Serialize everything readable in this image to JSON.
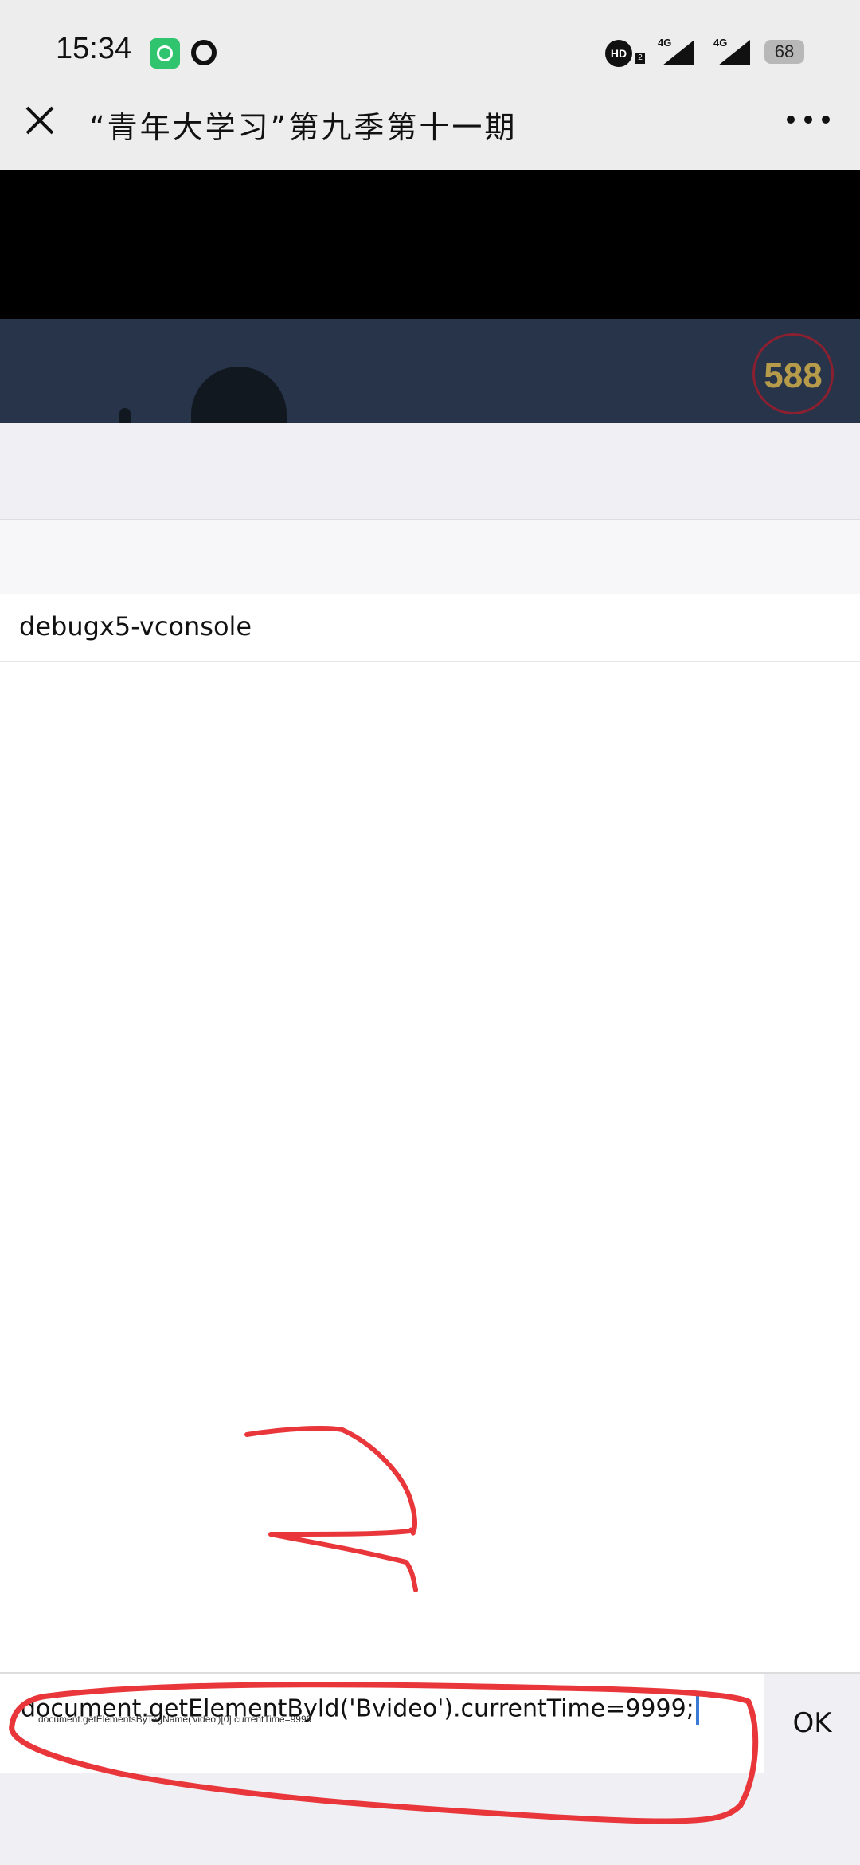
{
  "status_bar": {
    "time": "15:34",
    "hd_label": "HD",
    "hd_sub": "2",
    "net1": "4G",
    "net2": "4G",
    "battery": "68"
  },
  "title_bar": {
    "title": "“青年大学习”第九季第十一期",
    "close_icon": "close-icon",
    "more_icon": "more-icon"
  },
  "video": {
    "watermark": "588"
  },
  "vconsole": {
    "title": "debugx5-vconsole"
  },
  "command": {
    "value": "document.getElementById('Bvideo').currentTime=9999;",
    "autocomplete_hint": "document.getElementsByTagName('video')[0].currentTime=9999",
    "ok_label": "OK"
  },
  "colors": {
    "annotation": "#e8363a",
    "caret": "#3a7bd5",
    "header_bg": "#ededed"
  }
}
